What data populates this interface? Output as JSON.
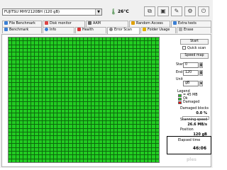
{
  "header": {
    "drive": "FUJITSU MHY2120BH (120 gB)",
    "temperature": "26°C"
  },
  "toolbar": {
    "buttons": [
      "copy-icon",
      "save-icon",
      "options-icon",
      "info-icon",
      "exit-icon"
    ]
  },
  "tabs_row1": [
    {
      "label": "File Benchmark"
    },
    {
      "label": "Disk monitor"
    },
    {
      "label": "AAM"
    },
    {
      "label": "Random Access"
    },
    {
      "label": "Extra tests"
    }
  ],
  "tabs_row2": [
    {
      "label": "Benchmark"
    },
    {
      "label": "Info"
    },
    {
      "label": "Health"
    },
    {
      "label": "Error Scan",
      "active": true
    },
    {
      "label": "Folder Usage"
    },
    {
      "label": "Erase"
    }
  ],
  "scan": {
    "start_button": "Start",
    "quick_scan": "Quick scan",
    "speed_map_button": "Speed map",
    "start_label": "Start",
    "start_value": "0",
    "end_label": "End",
    "end_value": "120",
    "unit_label": "Unit",
    "unit_value": "gB",
    "legend_title": "Legend",
    "legend_block": "= 45 MB",
    "legend_ok": "Ok",
    "legend_damaged": "Damaged",
    "damaged_blocks_label": "Damaged blocks",
    "damaged_blocks_value": "0.0 %",
    "damaged_blocks_fill": 0,
    "scanning_speed_label": "Scanning speed",
    "scanning_speed_value": "26.6 MB/s",
    "position_label": "Position",
    "position_value": "120 gB",
    "elapsed_label": "Elapsed time",
    "elapsed_value": "46:06"
  },
  "watermark": "ples",
  "colors": {
    "block_ok": "#22cc22",
    "block_damaged": "#ff0000"
  }
}
